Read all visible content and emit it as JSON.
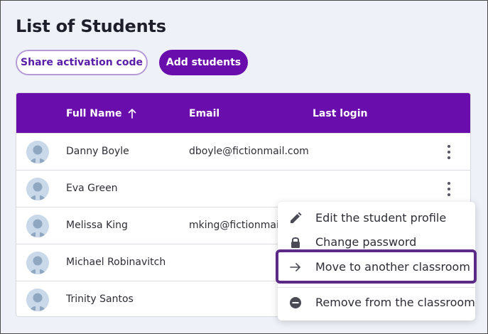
{
  "page": {
    "title": "List of Students"
  },
  "actions": {
    "share_label": "Share activation code",
    "add_label": "Add students"
  },
  "table": {
    "columns": [
      "Full Name",
      "Email",
      "Last login"
    ],
    "sort_indicator": "arrow-up-icon",
    "rows": [
      {
        "name": "Danny Boyle",
        "email": "dboyle@fictionmail.com",
        "last_login": ""
      },
      {
        "name": "Eva Green",
        "email": "",
        "last_login": ""
      },
      {
        "name": "Melissa King",
        "email": "mking@fictionmail.",
        "last_login": ""
      },
      {
        "name": "Michael Robinavitch",
        "email": "",
        "last_login": ""
      },
      {
        "name": "Trinity Santos",
        "email": "",
        "last_login": ""
      }
    ]
  },
  "context_menu": {
    "items": [
      {
        "label": "Edit the student profile",
        "icon": "pencil-icon"
      },
      {
        "label": "Change password",
        "icon": "lock-icon"
      },
      {
        "label": "Move to another classroom",
        "icon": "arrow-right-icon",
        "highlighted": true
      },
      {
        "label": "Remove from the classroom",
        "icon": "minus-circle-icon"
      }
    ]
  },
  "colors": {
    "accent": "#6a0dad",
    "highlight_border": "#5b2a86",
    "background": "#eef2f8"
  }
}
